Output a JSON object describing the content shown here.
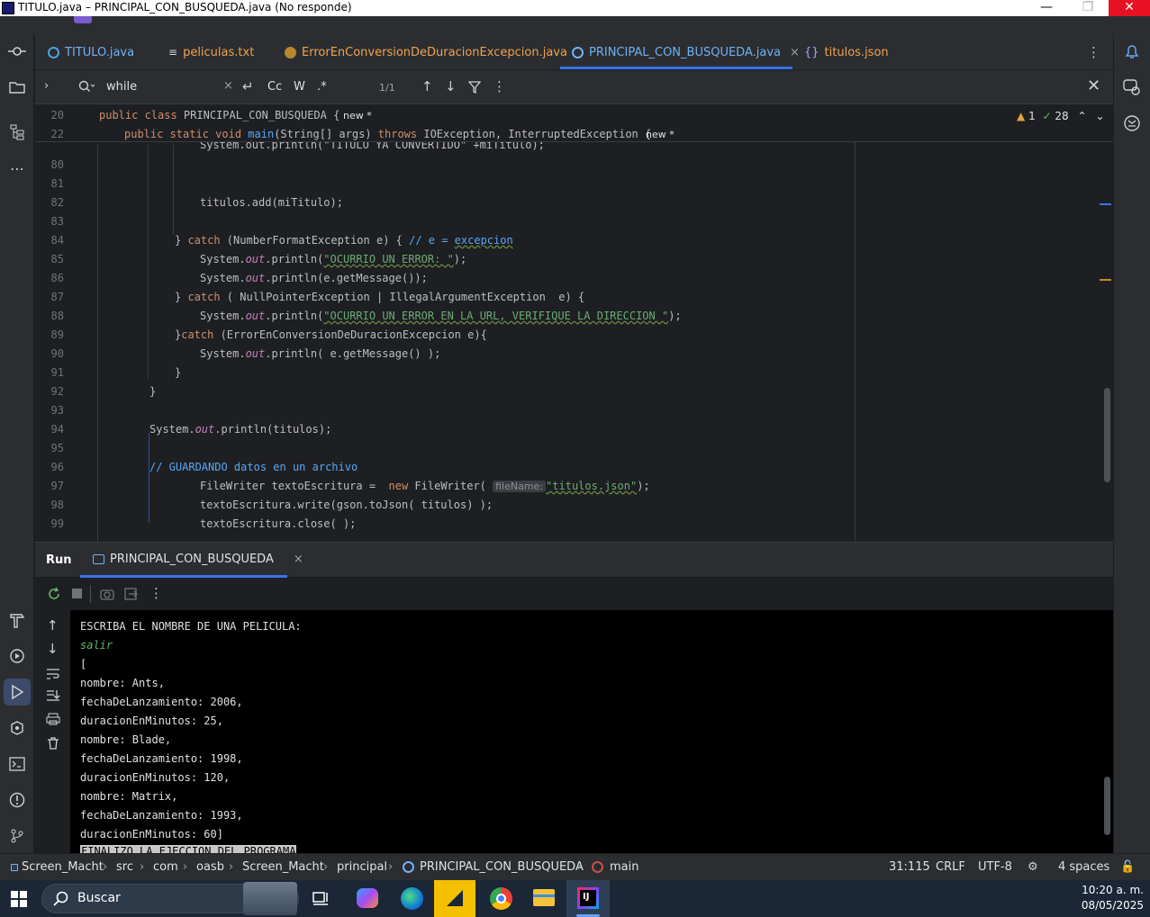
{
  "window": {
    "title": "TITULO.java – PRINCIPAL_CON_BUSQUEDA.java (No responde)"
  },
  "tabs": [
    {
      "label": "TITULO.java",
      "icon": "class-icon",
      "color": "#4aa3df"
    },
    {
      "label": "peliculas.txt",
      "icon": "text-file-icon",
      "color": "#f0a24d"
    },
    {
      "label": "ErrorEnConversionDeDuracionExcepcion.java",
      "icon": "exception-icon",
      "color": "#f0a24d"
    },
    {
      "label": "PRINCIPAL_CON_BUSQUEDA.java",
      "icon": "class-icon",
      "color": "#6fb1f5",
      "active": true
    },
    {
      "label": "titulos.json",
      "icon": "json-icon",
      "color": "#f0a24d"
    }
  ],
  "find": {
    "query": "while",
    "case": "Cc",
    "word": "W",
    "regex": ".*",
    "count": "1/1"
  },
  "sticky": [
    {
      "num": "20",
      "code": "public class PRINCIPAL_CON_BUSQUEDA {",
      "hint": "new *"
    },
    {
      "num": "22",
      "code": "public static void main(String[] args) throws IOException, InterruptedException {",
      "hint": "new *"
    }
  ],
  "inspection": {
    "warnings": "1",
    "checks": "28"
  },
  "editor_hidden_line": "System.out.println(\"TITULO YA CONVERTIDO\" +miTitulo);",
  "lines": {
    "l80": "80",
    "l81": "81",
    "l82": "82",
    "l83": "83",
    "l84": "84",
    "l85": "85",
    "l86": "86",
    "l87": "87",
    "l88": "88",
    "l89": "89",
    "l90": "90",
    "l91": "91",
    "l92": "92",
    "l93": "93",
    "l94": "94",
    "l95": "95",
    "l96": "96",
    "l97": "97",
    "l98": "98",
    "l99": "99"
  },
  "code": {
    "c82a": "titulos.add(miTitulo);",
    "c84a": "} ",
    "c84b": "catch",
    "c84c": " (NumberFormatException e) { ",
    "c84d": "// e = ",
    "c84e": "excepcion",
    "c85a": "System.",
    "c85b": "out",
    "c85c": ".println(",
    "c85d": "\"OCURRIO UN ERROR: \"",
    "c85e": ");",
    "c86a": "System.",
    "c86b": "out",
    "c86c": ".println(e.getMessage());",
    "c87a": "} ",
    "c87b": "catch",
    "c87c": " ( NullPointerException | IllegalArgumentException  e) {",
    "c88a": "System.",
    "c88b": "out",
    "c88c": ".println(",
    "c88d": "\"OCURRIO UN ERROR EN LA URL, VERIFIQUE LA DIRECCION \"",
    "c88e": ");",
    "c89a": "}",
    "c89b": "catch",
    "c89c": " (ErrorEnConversionDeDuracionExcepcion e){",
    "c90a": "System.",
    "c90b": "out",
    "c90c": ".println( e.getMessage() );",
    "c91a": "}",
    "c92a": "}",
    "c94a": "System.",
    "c94b": "out",
    "c94c": ".println(titulos);",
    "c96a": "// GUARDANDO datos en un archivo",
    "c97a": "FileWriter textoEscritura =  ",
    "c97b": "new",
    "c97c": " FileWriter( ",
    "c97hint": "fileName:",
    "c97d": "\"titulos.json\"",
    "c97e": ");",
    "c98a": "textoEscritura.write(gson.toJson( titulos) );",
    "c99a": "textoEscritura.close( );"
  },
  "run": {
    "title": "Run",
    "config": "PRINCIPAL_CON_BUSQUEDA"
  },
  "console": [
    "ESCRIBA EL NOMBRE DE UNA PELICULA:",
    "salir",
    "[",
    "nombre: Ants,",
    "fechaDeLanzamiento: 2006,",
    "duracionEnMinutos: 25,",
    "nombre: Blade,",
    "fechaDeLanzamiento: 1998,",
    "duracionEnMinutos: 120,",
    "nombre: Matrix,",
    "fechaDeLanzamiento: 1993,",
    "duracionEnMinutos: 60]",
    "FINALIZO LA EJECCION DEL PROGRAMA"
  ],
  "breadcrumbs": [
    "Screen_Macht",
    "src",
    "com",
    "oasb",
    "Screen_Macht",
    "principal",
    "PRINCIPAL_CON_BUSQUEDA",
    "main"
  ],
  "status": {
    "position": "31:115",
    "line_sep": "CRLF",
    "encoding": "UTF-8",
    "indent": "4 spaces"
  },
  "taskbar": {
    "search": "Buscar",
    "time": "10:20 a. m.",
    "date": "08/05/2025"
  }
}
